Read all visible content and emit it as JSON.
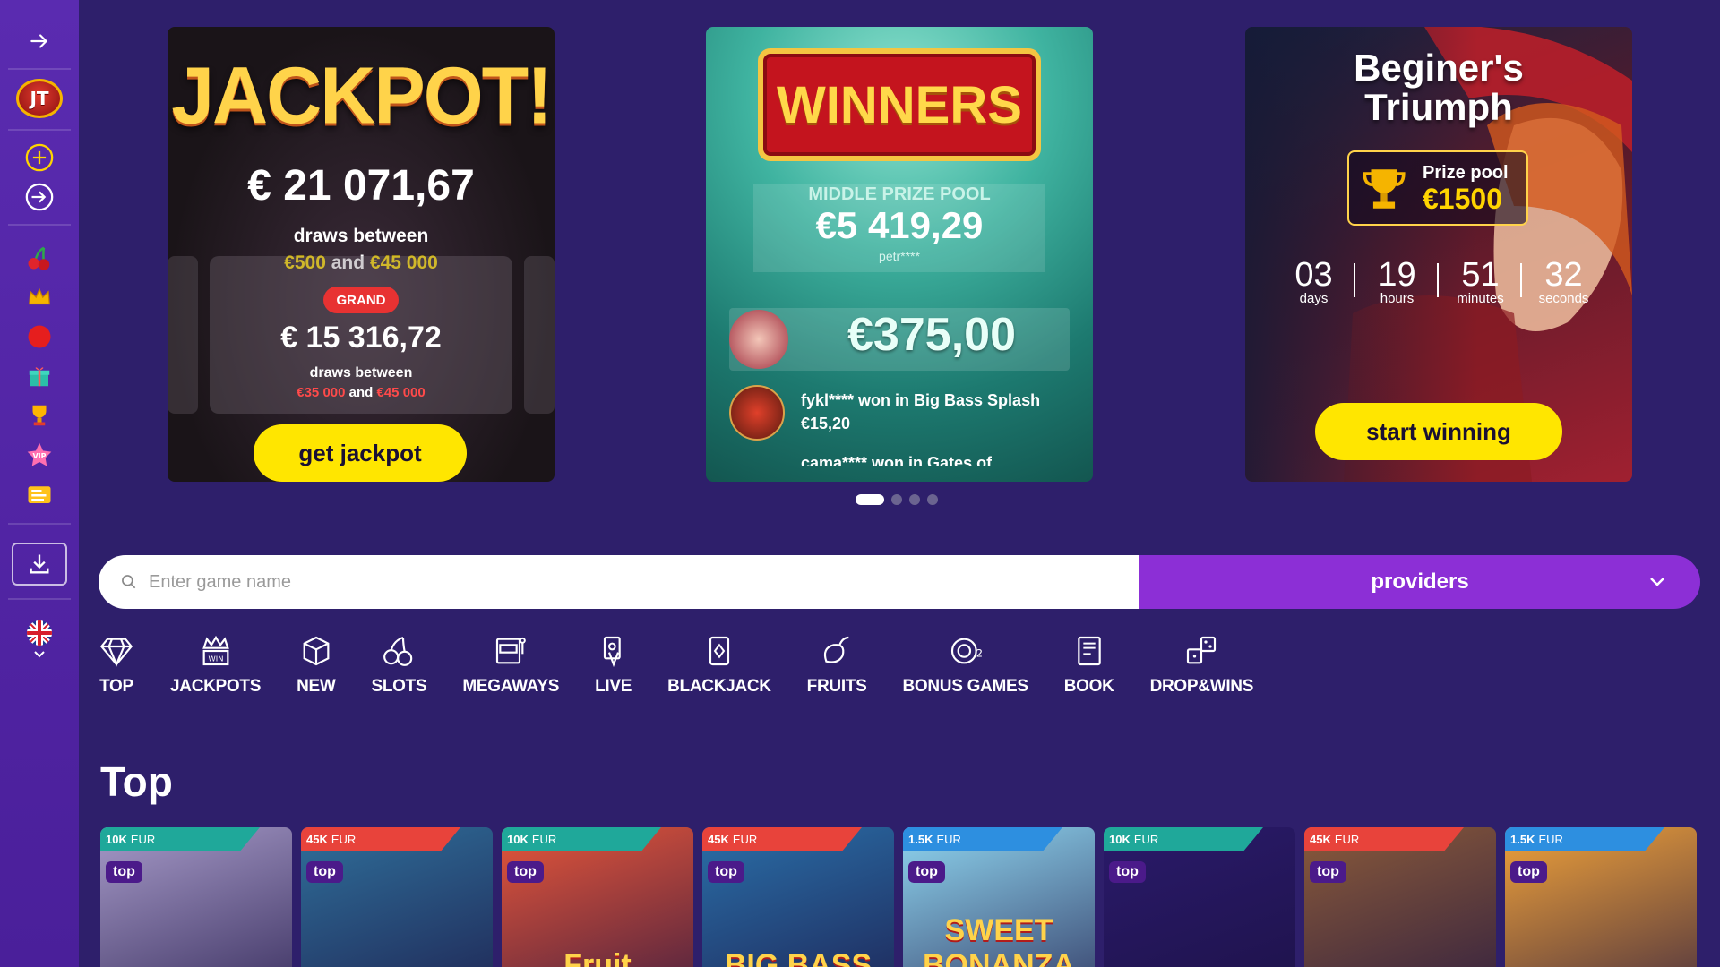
{
  "sidebar": {
    "logo_text": "JT",
    "items": [
      {
        "icon": "arrow-right-icon"
      },
      {
        "icon": "plus-circle-icon"
      },
      {
        "icon": "login-icon"
      },
      {
        "icon": "cherry-icon"
      },
      {
        "icon": "crown-icon"
      },
      {
        "icon": "live-dot-icon"
      },
      {
        "icon": "gift-icon"
      },
      {
        "icon": "trophy-icon"
      },
      {
        "icon": "vip-star-icon"
      },
      {
        "icon": "news-icon"
      },
      {
        "icon": "download-icon"
      },
      {
        "icon": "uk-flag-icon"
      }
    ]
  },
  "banners": {
    "jackpot": {
      "title": "JACKPOT!",
      "amount": "€ 21 071,67",
      "draws_label": "draws between",
      "range_low": "€500",
      "and": "and",
      "range_high": "€45 000",
      "grand_badge": "GRAND",
      "grand_amount": "€ 15 316,72",
      "grand_draws_label": "draws between",
      "grand_low": "€35 000",
      "grand_and": "and",
      "grand_high": "€45 000",
      "button": "get jackpot"
    },
    "winners": {
      "sign": "WINNERS",
      "pool_label": "MIDDLE PRIZE POOL",
      "pool_amount": "€5 419,29",
      "pool_user": "petr****",
      "big_win": "€375,00",
      "feed_1_line1": "fykl**** won in Big Bass Splash",
      "feed_1_line2": "€15,20",
      "feed_2_line1": "cama**** won in Gates of"
    },
    "tournament": {
      "title_line1": "Beginer's",
      "title_line2": "Triumph",
      "prize_label": "Prize pool",
      "prize_value": "€1500",
      "days": "03",
      "days_label": "days",
      "hours": "19",
      "hours_label": "hours",
      "minutes": "51",
      "minutes_label": "minutes",
      "seconds": "32",
      "seconds_label": "seconds",
      "button": "start winning"
    }
  },
  "carousel": {
    "count": 4,
    "active": 0
  },
  "search": {
    "placeholder": "Enter game name",
    "value": ""
  },
  "providers": {
    "label": "providers"
  },
  "categories": [
    "TOP",
    "JACKPOTS",
    "NEW",
    "SLOTS",
    "MEGAWAYS",
    "LIVE",
    "BLACKJACK",
    "FRUITS",
    "BONUS GAMES",
    "BOOK",
    "DROP&WINS"
  ],
  "section": {
    "title": "Top"
  },
  "tiles": [
    {
      "jackpot": "10K",
      "currency": "EUR",
      "tag": "top",
      "ribbon_color": "#1fa89a",
      "bg": "#a69ac8",
      "name": ""
    },
    {
      "jackpot": "45K",
      "currency": "EUR",
      "tag": "top",
      "ribbon_color": "#e8433b",
      "bg": "#2f6f9a",
      "name": ""
    },
    {
      "jackpot": "10K",
      "currency": "EUR",
      "tag": "top",
      "ribbon_color": "#1fa89a",
      "bg": "#e6563a",
      "name": "Fruit"
    },
    {
      "jackpot": "45K",
      "currency": "EUR",
      "tag": "top",
      "ribbon_color": "#e8433b",
      "bg": "#2a6fa8",
      "name": "BIG BASS"
    },
    {
      "jackpot": "1.5K",
      "currency": "EUR",
      "tag": "top",
      "ribbon_color": "#2d8fe0",
      "bg": "#8fd6f0",
      "name": "SWEET BONANZA"
    },
    {
      "jackpot": "10K",
      "currency": "EUR",
      "tag": "top",
      "ribbon_color": "#1fa89a",
      "bg": "#2a1a6a",
      "name": ""
    },
    {
      "jackpot": "45K",
      "currency": "EUR",
      "tag": "top",
      "ribbon_color": "#e8433b",
      "bg": "#8a5a3a",
      "name": ""
    },
    {
      "jackpot": "1.5K",
      "currency": "EUR",
      "tag": "top",
      "ribbon_color": "#2d8fe0",
      "bg": "#f0a23a",
      "name": ""
    }
  ],
  "colors": {
    "bg": "#2e1f6b",
    "sidebar": "#5a2bb0",
    "accent_yellow": "#ffe600",
    "providers": "#8c2fd6"
  }
}
